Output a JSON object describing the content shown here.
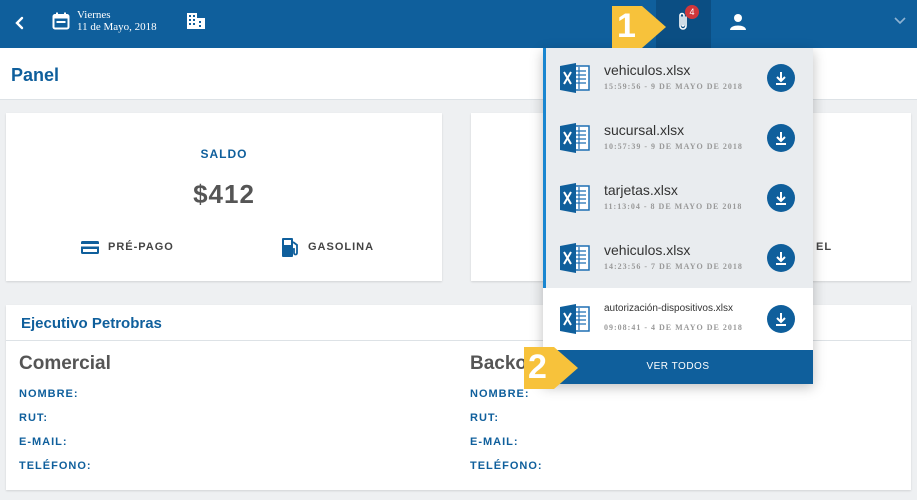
{
  "topbar": {
    "date_weekday": "Viernes",
    "date_full": "11 de Mayo, 2018",
    "attachments_badge": "4"
  },
  "panel": {
    "title": "Panel"
  },
  "saldo_card": {
    "label": "SALDO",
    "amount": "$412",
    "tag_prepago": "PRÉ-PAGO",
    "tag_gasolina": "GASOLINA"
  },
  "card2": {
    "partial_text": "EL"
  },
  "executive": {
    "title": "Ejecutivo Petrobras",
    "col_left_title": "Comercial",
    "col_right_title": "Backoffice",
    "col_right_title_visible": "Backo",
    "fields": [
      "NOMBRE:",
      "RUT:",
      "E-MAIL:",
      "TELÉFONO:"
    ]
  },
  "downloads": {
    "items": [
      {
        "name": "vehiculos.xlsx",
        "meta": "15:59:56 - 9 DE MAYO DE 2018",
        "state": "unread"
      },
      {
        "name": "sucursal.xlsx",
        "meta": "10:57:39 - 9 DE MAYO DE 2018",
        "state": "unread"
      },
      {
        "name": "tarjetas.xlsx",
        "meta": "11:13:04 - 8 DE MAYO DE 2018",
        "state": "unread"
      },
      {
        "name": "vehiculos.xlsx",
        "meta": "14:23:56 - 7 DE MAYO DE 2018",
        "state": "unread"
      },
      {
        "name": "autorización-dispositivos.xlsx",
        "meta": "09:08:41 - 4 DE MAYO DE 2018",
        "state": "read"
      }
    ],
    "ver_todos": "VER TODOS"
  },
  "callouts": {
    "first": "1",
    "second": "2"
  },
  "colors": {
    "primary": "#0f5f9c",
    "callout": "#f7c23b",
    "badge": "#d0363b",
    "unread_bar": "#1a86d0"
  },
  "icons": [
    "back-icon",
    "calendar-icon",
    "building-icon",
    "paperclip-icon",
    "user-icon",
    "chevron-down-icon",
    "credit-card-icon",
    "fuel-pump-icon",
    "excel-icon",
    "download-icon"
  ]
}
